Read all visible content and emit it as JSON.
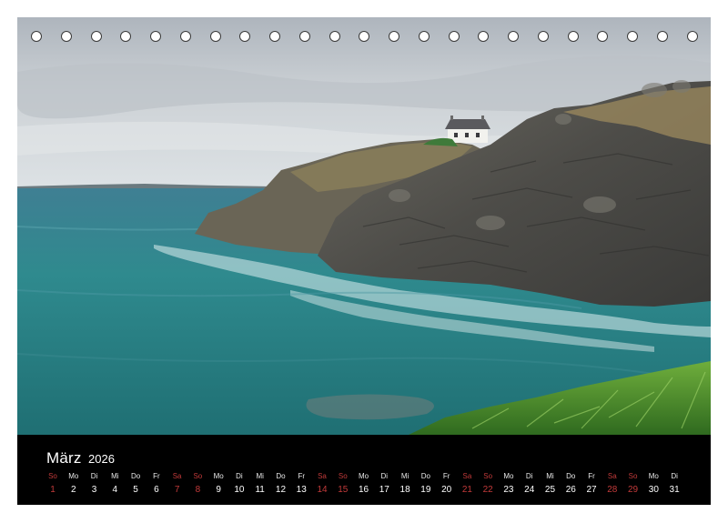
{
  "calendar": {
    "month": "März",
    "year": "2026",
    "days": [
      {
        "wd": "So",
        "d": "1",
        "weekend": true
      },
      {
        "wd": "Mo",
        "d": "2",
        "weekend": false
      },
      {
        "wd": "Di",
        "d": "3",
        "weekend": false
      },
      {
        "wd": "Mi",
        "d": "4",
        "weekend": false
      },
      {
        "wd": "Do",
        "d": "5",
        "weekend": false
      },
      {
        "wd": "Fr",
        "d": "6",
        "weekend": false
      },
      {
        "wd": "Sa",
        "d": "7",
        "weekend": true
      },
      {
        "wd": "So",
        "d": "8",
        "weekend": true
      },
      {
        "wd": "Mo",
        "d": "9",
        "weekend": false
      },
      {
        "wd": "Di",
        "d": "10",
        "weekend": false
      },
      {
        "wd": "Mi",
        "d": "11",
        "weekend": false
      },
      {
        "wd": "Do",
        "d": "12",
        "weekend": false
      },
      {
        "wd": "Fr",
        "d": "13",
        "weekend": false
      },
      {
        "wd": "Sa",
        "d": "14",
        "weekend": true
      },
      {
        "wd": "So",
        "d": "15",
        "weekend": true
      },
      {
        "wd": "Mo",
        "d": "16",
        "weekend": false
      },
      {
        "wd": "Di",
        "d": "17",
        "weekend": false
      },
      {
        "wd": "Mi",
        "d": "18",
        "weekend": false
      },
      {
        "wd": "Do",
        "d": "19",
        "weekend": false
      },
      {
        "wd": "Fr",
        "d": "20",
        "weekend": false
      },
      {
        "wd": "Sa",
        "d": "21",
        "weekend": true
      },
      {
        "wd": "So",
        "d": "22",
        "weekend": true
      },
      {
        "wd": "Mo",
        "d": "23",
        "weekend": false
      },
      {
        "wd": "Di",
        "d": "24",
        "weekend": false
      },
      {
        "wd": "Mi",
        "d": "25",
        "weekend": false
      },
      {
        "wd": "Do",
        "d": "26",
        "weekend": false
      },
      {
        "wd": "Fr",
        "d": "27",
        "weekend": false
      },
      {
        "wd": "Sa",
        "d": "28",
        "weekend": true
      },
      {
        "wd": "So",
        "d": "29",
        "weekend": true
      },
      {
        "wd": "Mo",
        "d": "30",
        "weekend": false
      },
      {
        "wd": "Di",
        "d": "31",
        "weekend": false
      }
    ]
  },
  "colors": {
    "weekend": "#c23a3a",
    "calendar_bar": "#000000",
    "sea": "#2e8a8c",
    "sky": "#c9ced3",
    "rock": "#5b5a55"
  }
}
